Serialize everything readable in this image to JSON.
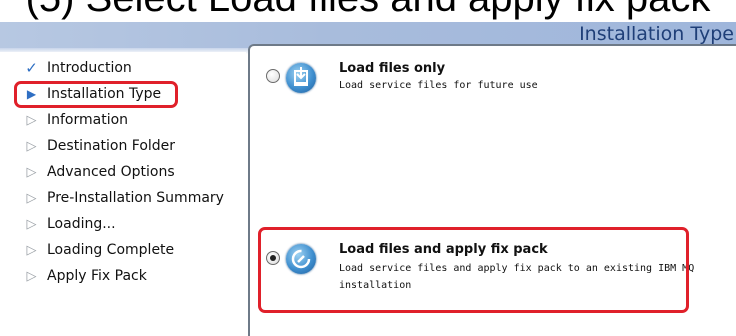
{
  "caption": {
    "text": "(5) Select Load files and apply fix pack"
  },
  "header": {
    "title": "Installation Type"
  },
  "sidebar": {
    "steps": [
      {
        "label": "Introduction",
        "state": "done"
      },
      {
        "label": "Installation Type",
        "state": "current"
      },
      {
        "label": "Information",
        "state": "pending"
      },
      {
        "label": "Destination Folder",
        "state": "pending"
      },
      {
        "label": "Advanced Options",
        "state": "pending"
      },
      {
        "label": "Pre-Installation Summary",
        "state": "pending"
      },
      {
        "label": "Loading...",
        "state": "pending"
      },
      {
        "label": "Loading Complete",
        "state": "pending"
      },
      {
        "label": "Apply Fix Pack",
        "state": "pending"
      }
    ]
  },
  "options": {
    "load_only": {
      "title": "Load files only",
      "description": "Load service files for future use",
      "selected": false,
      "icon": "download-icon"
    },
    "load_apply": {
      "title": "Load files and apply fix pack",
      "description_line1": "Load service files and apply fix pack to an existing IBM MQ",
      "description_line2": "installation",
      "selected": true,
      "icon": "refresh-wrench-icon"
    }
  },
  "colors": {
    "highlight": "#e0202a",
    "header_text": "#1f3f78",
    "accent": "#2f6fc3"
  }
}
